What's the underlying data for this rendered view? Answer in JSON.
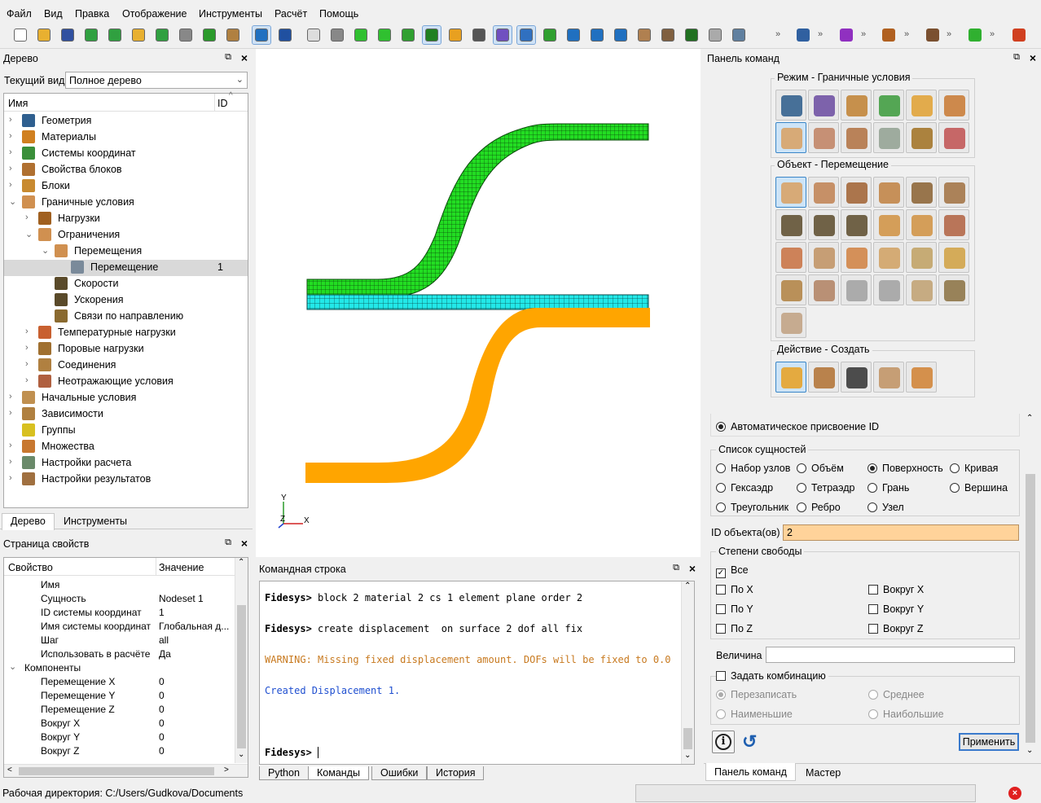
{
  "menu": [
    "Файл",
    "Вид",
    "Правка",
    "Отображение",
    "Инструменты",
    "Расчёт",
    "Помощь"
  ],
  "tree_panel": {
    "title": "Дерево",
    "current_view_label": "Текущий вид",
    "current_view_value": "Полное дерево",
    "col_name": "Имя",
    "col_id": "ID",
    "items": [
      {
        "label": "Геометрия",
        "level": 0,
        "exp": "closed",
        "icon": "geometry-icon",
        "color": "#2f5f8f"
      },
      {
        "label": "Материалы",
        "level": 0,
        "exp": "closed",
        "icon": "materials-icon",
        "color": "#d08020"
      },
      {
        "label": "Системы координат",
        "level": 0,
        "exp": "closed",
        "icon": "coord-system-icon",
        "color": "#3a8f3a"
      },
      {
        "label": "Свойства блоков",
        "level": 0,
        "exp": "closed",
        "icon": "block-props-icon",
        "color": "#b07030"
      },
      {
        "label": "Блоки",
        "level": 0,
        "exp": "closed",
        "icon": "blocks-icon",
        "color": "#c88a30"
      },
      {
        "label": "Граничные условия",
        "level": 0,
        "exp": "open",
        "icon": "bc-icon",
        "color": "#d09050"
      },
      {
        "label": "Нагрузки",
        "level": 1,
        "exp": "closed",
        "icon": "loads-icon",
        "color": "#a06020"
      },
      {
        "label": "Ограничения",
        "level": 1,
        "exp": "open",
        "icon": "constraints-icon",
        "color": "#d09050"
      },
      {
        "label": "Перемещения",
        "level": 2,
        "exp": "open",
        "icon": "displacements-icon",
        "color": "#d09050"
      },
      {
        "label": "Перемещение",
        "level": 3,
        "exp": "none",
        "icon": "displacement-icon",
        "color": "#7a8a9a",
        "id": "1",
        "selected": true
      },
      {
        "label": "Скорости",
        "level": 2,
        "exp": "none",
        "icon": "velocity-icon",
        "color": "#5a4a2a"
      },
      {
        "label": "Ускорения",
        "level": 2,
        "exp": "none",
        "icon": "acceleration-icon",
        "color": "#5a4a2a"
      },
      {
        "label": "Связи по направлению",
        "level": 2,
        "exp": "none",
        "icon": "direction-link-icon",
        "color": "#8a6a30"
      },
      {
        "label": "Температурные нагрузки",
        "level": 1,
        "exp": "closed",
        "icon": "thermal-icon",
        "color": "#c86030"
      },
      {
        "label": "Поровые нагрузки",
        "level": 1,
        "exp": "closed",
        "icon": "pore-icon",
        "color": "#a07030"
      },
      {
        "label": "Соединения",
        "level": 1,
        "exp": "closed",
        "icon": "connections-icon",
        "color": "#b08040"
      },
      {
        "label": "Неотражающие условия",
        "level": 1,
        "exp": "closed",
        "icon": "nonreflect-icon",
        "color": "#b06040"
      },
      {
        "label": "Начальные условия",
        "level": 0,
        "exp": "closed",
        "icon": "initial-icon",
        "color": "#c09050"
      },
      {
        "label": "Зависимости",
        "level": 0,
        "exp": "closed",
        "icon": "dependencies-icon",
        "color": "#b08040"
      },
      {
        "label": "Группы",
        "level": 0,
        "exp": "none",
        "icon": "groups-icon",
        "color": "#d8c020"
      },
      {
        "label": "Множества",
        "level": 0,
        "exp": "closed",
        "icon": "sets-icon",
        "color": "#c87830"
      },
      {
        "label": "Настройки расчета",
        "level": 0,
        "exp": "closed",
        "icon": "calc-settings-icon",
        "color": "#6a8a6a"
      },
      {
        "label": "Настройки результатов",
        "level": 0,
        "exp": "closed",
        "icon": "results-settings-icon",
        "color": "#a07040"
      }
    ],
    "tabs": [
      "Дерево",
      "Инструменты"
    ]
  },
  "props_panel": {
    "title": "Страница свойств",
    "col_prop": "Свойство",
    "col_val": "Значение",
    "rows": [
      {
        "name": "Имя",
        "value": "",
        "indent": 1
      },
      {
        "name": "Сущность",
        "value": "Nodeset 1",
        "indent": 1
      },
      {
        "name": "ID системы координат",
        "value": "1",
        "indent": 1
      },
      {
        "name": "Имя системы координат",
        "value": "Глобальная д...",
        "indent": 1
      },
      {
        "name": "Шаг",
        "value": "all",
        "indent": 1
      },
      {
        "name": "Использовать в расчёте",
        "value": "Да",
        "indent": 1
      },
      {
        "name": "Компоненты",
        "value": "",
        "indent": 0,
        "group": true
      },
      {
        "name": "Перемещение X",
        "value": "0",
        "indent": 1
      },
      {
        "name": "Перемещение Y",
        "value": "0",
        "indent": 1
      },
      {
        "name": "Перемещение Z",
        "value": "0",
        "indent": 1
      },
      {
        "name": "Вокруг X",
        "value": "0",
        "indent": 1
      },
      {
        "name": "Вокруг Y",
        "value": "0",
        "indent": 1
      },
      {
        "name": "Вокруг Z",
        "value": "0",
        "indent": 1
      }
    ]
  },
  "viewport": {
    "axes": {
      "y": "Y",
      "z": "Z",
      "x": "X"
    },
    "colors": {
      "green": "#22dd22",
      "cyan": "#22e8e8",
      "orange": "#ffa500"
    }
  },
  "command_panel": {
    "title": "Командная строка",
    "lines": [
      {
        "prompt": "Fidesys>",
        "text": " block 2 material 2 cs 1 element plane order 2",
        "kind": "cmd"
      },
      {
        "prompt": "Fidesys>",
        "text": " create displacement  on surface 2 dof all fix",
        "kind": "cmd"
      },
      {
        "prompt": "",
        "text": "WARNING: Missing fixed displacement amount. DOFs will be fixed to 0.0",
        "kind": "warn"
      },
      {
        "prompt": "",
        "text": "Created Displacement 1.",
        "kind": "info"
      },
      {
        "prompt": "Fidesys>",
        "text": " ",
        "kind": "cmd"
      }
    ],
    "tabs": [
      "Python",
      "Команды",
      "Ошибки",
      "История"
    ],
    "colors": {
      "warn": "#c87a20",
      "info": "#1f4fd0"
    }
  },
  "right_panel": {
    "title": "Панель команд",
    "mode_title": "Режим - Граничные условия",
    "object_title": "Объект - Перемещение",
    "action_title": "Действие - Создать",
    "mode_buttons": [
      "geometry-mode-icon",
      "mesh-mode-icon",
      "materials-mode-icon",
      "coord-mode-icon",
      "blocks-mode-icon",
      "sets-mode-icon",
      "bc-mode-icon",
      "initial-mode-icon",
      "function-mode-icon",
      "calc-mode-icon",
      "results-mode-icon",
      "analysis-mode-icon"
    ],
    "object_buttons": [
      "displacement-obj-icon",
      "force-icon",
      "pressure-icon",
      "distributed-icon",
      "gravity-icon",
      "body-force-icon",
      "velocity-obj-icon",
      "angular-velocity-icon",
      "acceleration-obj-icon",
      "column-icon",
      "link-icon",
      "interface-icon",
      "temperature-icon",
      "heat-flux-icon",
      "convection-icon",
      "radiation-icon",
      "light-icon",
      "sun-icon",
      "pore-obj-icon",
      "fluid-icon",
      "point-source-icon",
      "point-sun-icon",
      "contact-icon",
      "hinge-icon",
      "assembly-icon"
    ],
    "action_buttons": [
      "create-icon",
      "edit-tool-icon",
      "list-icon",
      "modify-icon",
      "delete-icon"
    ],
    "auto_id": "Автоматическое присвоение ID",
    "entity_list_title": "Список сущностей",
    "entity_options": [
      "Набор узлов",
      "Объём",
      "Поверхность",
      "Кривая",
      "Гексаэдр",
      "Тетраэдр",
      "Грань",
      "Вершина",
      "Треугольник",
      "Ребро",
      "Узел"
    ],
    "entity_selected": "Поверхность",
    "object_id_label": "ID объекта(ов)",
    "object_id_value": "2",
    "dof_title": "Степени свободы",
    "dof_options": [
      "Все",
      "По X",
      "Вокруг X",
      "По Y",
      "Вокруг Y",
      "По Z",
      "Вокруг Z"
    ],
    "magnitude_label": "Величина",
    "magnitude_value": "",
    "combine_label": "Задать комбинацию",
    "combine_options": [
      "Перезаписать",
      "Среднее",
      "Наименьшие",
      "Наибольшие"
    ],
    "apply": "Применить",
    "tabs": [
      "Панель команд",
      "Мастер"
    ]
  },
  "status": {
    "workdir": "Рабочая директория: C:/Users/Gudkova/Documents"
  }
}
